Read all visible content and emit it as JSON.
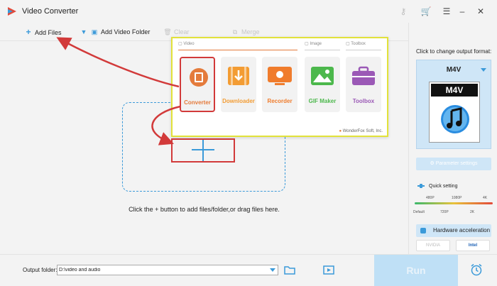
{
  "app": {
    "title": "Video Converter"
  },
  "toolbar": {
    "add_files": "Add Files",
    "add_video_folder": "Add Video Folder",
    "clear": "Clear",
    "merge": "Merge"
  },
  "popup": {
    "sections": [
      "Video",
      "Image",
      "Toolbox"
    ],
    "tiles": [
      {
        "label": "Converter",
        "color": "#e47b3c"
      },
      {
        "label": "Downloader",
        "color": "#f39c33"
      },
      {
        "label": "Recorder",
        "color": "#f07c2c"
      },
      {
        "label": "GIF Maker",
        "color": "#4cb84c"
      },
      {
        "label": "Toolbox",
        "color": "#9b59b6"
      }
    ],
    "brand": "WonderFox Soft, Inc."
  },
  "workspace": {
    "hint": "Click the + button to add files/folder,or drag files here."
  },
  "sidebar": {
    "title": "Click to change output format:",
    "format": "M4V",
    "format_tag": "M4V",
    "parameter_settings": "Parameter settings",
    "quick_setting": "Quick setting",
    "res_top": [
      "480P",
      "1080P",
      "4K"
    ],
    "res_bottom": [
      "Default",
      "720P",
      "2K"
    ],
    "hardware_acceleration": "Hardware acceleration",
    "vendors": [
      "NVIDIA",
      "Intel"
    ]
  },
  "footer": {
    "output_folder_label": "Output folder:",
    "output_folder_value": "D:\\video and audio",
    "run": "Run"
  },
  "colors": {
    "accent": "#3b9ad9",
    "highlight_red": "#d23a3a",
    "highlight_yellow": "#e2e23a"
  }
}
